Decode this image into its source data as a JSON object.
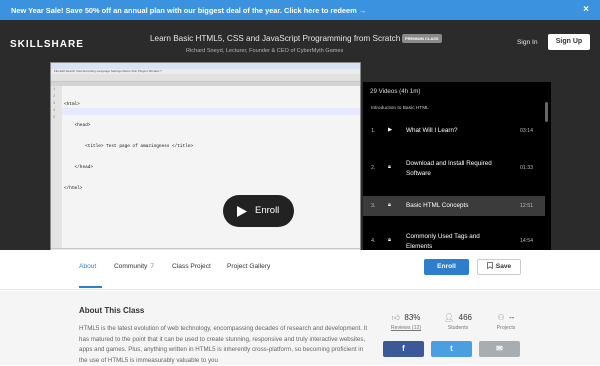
{
  "promo": {
    "text": "New Year Sale! Save 50% off an annual plan with our biggest deal of the year. Click here to redeem →",
    "close": "×"
  },
  "header": {
    "logo": "SKILLSHARE",
    "course_title": "Learn Basic HTML5, CSS and JavaScript Programming from Scratch",
    "badge": "PREMIUM CLASS",
    "author": "Richard Sneyd, Lecturer, Founder & CEO of CyberMyth Games",
    "sign_in": "Sign In",
    "sign_up": "Sign Up"
  },
  "video": {
    "menu": "File  Edit  Search  View  Encoding  Language  Settings  Macro  Run  Plugins  Window  ?",
    "code_lines": [
      "<html>",
      "    <head>",
      "        <title> Test page of amazingness </title>",
      "    </head>",
      "</html>"
    ],
    "line_numbers": [
      "1",
      "2",
      "3",
      "4",
      "5"
    ],
    "status": "Hyper Text Markup Language file        length : 95    lines : 5        Ln : 4   Col : 12   Sel : 0 | 0        Dos\\Windows        UTF-8 w/o BOM        INS",
    "enroll_label": "Enroll",
    "play_icon": "play-icon"
  },
  "playlist": {
    "header": "29 Videos (4h 1m)",
    "section": "Introduction to Basic HTML",
    "items": [
      {
        "num": "1.",
        "icon": "play-icon",
        "title": "What Will I Learn?",
        "time": "03:14"
      },
      {
        "num": "2.",
        "icon": "lock-icon",
        "title": "Download and Install Required Software",
        "time": "01:33"
      },
      {
        "num": "3.",
        "icon": "lock-icon",
        "title": "Basic HTML Concepts",
        "time": "12:51"
      },
      {
        "num": "4.",
        "icon": "lock-icon",
        "title": "Commonly Used Tags and Elements",
        "time": "14:54"
      }
    ]
  },
  "nav": {
    "tabs": [
      {
        "label": "About",
        "count": ""
      },
      {
        "label": "Community",
        "count": "7"
      },
      {
        "label": "Class Project",
        "count": ""
      },
      {
        "label": "Project Gallery",
        "count": ""
      }
    ],
    "enroll": "Enroll",
    "save": "Save"
  },
  "about": {
    "title": "About This Class",
    "text": "HTML5 is the latest evolution of web technology, encompassing decades of research and development. It has matured to the point that it can be used to create stunning, responsive and truly interactive websites, apps and games. Plus, anything written in HTML5 is inherently cross-platform, so becoming proficient in the use of HTML5 is immeasurably valuable to you"
  },
  "stats": [
    {
      "icon": "thumbs-up-icon",
      "value": "83%",
      "label": "Reviews (12)"
    },
    {
      "icon": "students-icon",
      "value": "466",
      "label": "Students"
    },
    {
      "icon": "projects-icon",
      "value": "--",
      "label": "Projects"
    }
  ],
  "share": [
    {
      "icon": "facebook-icon",
      "glyph": "f",
      "color": "#3b5998"
    },
    {
      "icon": "twitter-icon",
      "glyph": "t",
      "color": "#4a9fe0"
    },
    {
      "icon": "email-icon",
      "glyph": "✉",
      "color": "#a8adb2"
    }
  ],
  "colors": {
    "accent": "#2f7ecb",
    "promo": "#3b93e0",
    "hero": "#2b2b2b"
  }
}
